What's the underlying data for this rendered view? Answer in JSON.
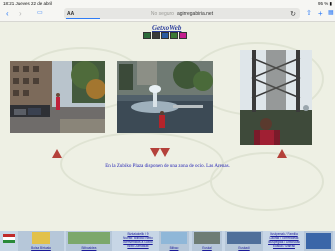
{
  "status": {
    "time": "18:21",
    "date": "Jueves 22 de abril",
    "battery": "95 %"
  },
  "browser": {
    "tab_label": "AA",
    "security": "No seguro",
    "url": "agirregabiria.net",
    "icons": [
      "back-icon",
      "forward-icon",
      "book-icon",
      "reload-icon",
      "share-icon",
      "new-tab-icon",
      "tabs-icon"
    ]
  },
  "site": {
    "logo": "GetxoWeb",
    "caption": "En la Zubiko Plaza disponen de una zona de ocio. Las Arenas."
  },
  "footer": {
    "left_label": "Bolsa Birtuala",
    "second_label": "Bilboaldea",
    "mid_links": [
      "Bizkaiakelik / 9",
      "Nuestr. Bilboko Netto",
      "Bienvenidos a Gotxo",
      "Bilbo Zarrakiak",
      "Getxo"
    ],
    "right_links": [
      "Itzulpenak / Familia",
      "Laurak / Torrebideak",
      "Ikuspegiak / Ditxosoak",
      "Euskal / Izarrak",
      "Euskadi / Tradicio",
      "Lekeitio / portua"
    ],
    "cell_labels": [
      "Bilbao",
      "Euskal",
      "Euskadi"
    ],
    "colors": {
      "bar": "#c7d6e6",
      "link": "#1c1c9a"
    }
  }
}
